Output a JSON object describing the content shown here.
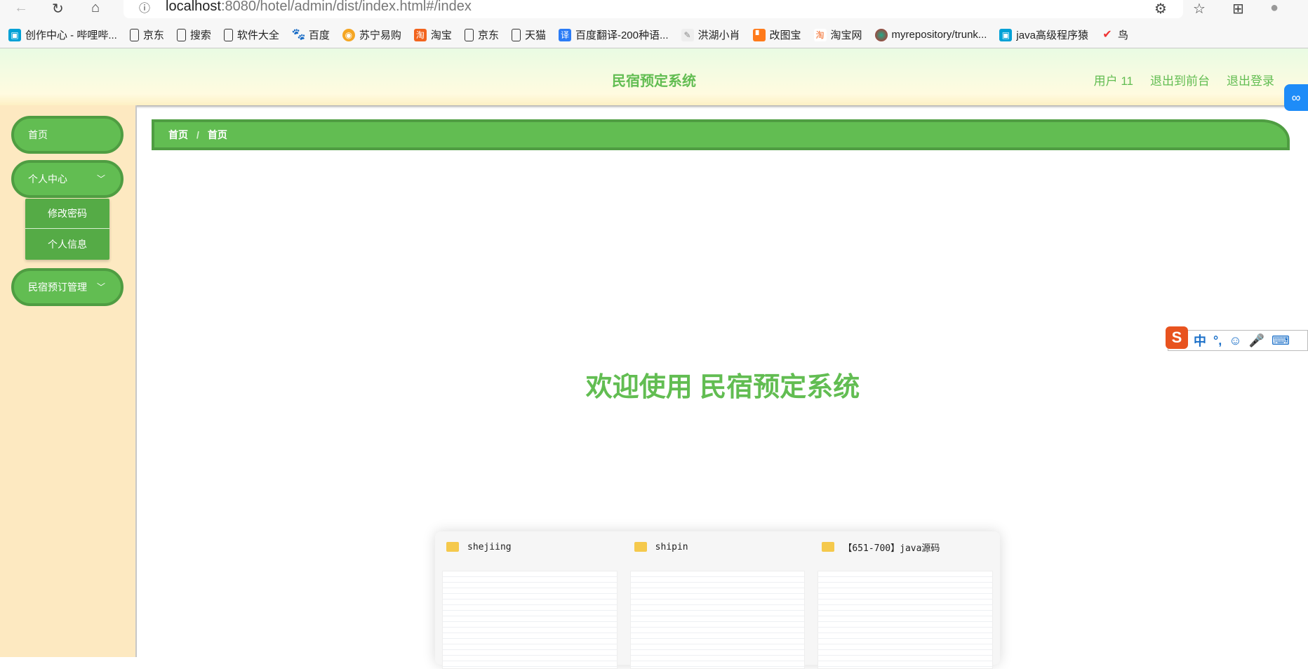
{
  "browser": {
    "url_host": "localhost",
    "url_rest": ":8080/hotel/admin/dist/index.html#/index"
  },
  "bookmarks": [
    "创作中心 - 哔哩哔...",
    "京东",
    "搜索",
    "软件大全",
    "百度",
    "苏宁易购",
    "淘宝",
    "京东",
    "天猫",
    "百度翻译-200种语...",
    "洪湖小肖",
    "改图宝",
    "淘宝网",
    "myrepository/trunk...",
    "java高级程序猿",
    "鸟"
  ],
  "header": {
    "title": "民宿预定系统",
    "user": "用户 11",
    "to_front": "退出到前台",
    "logout": "退出登录"
  },
  "sidebar": {
    "home": "首页",
    "personal": "个人中心",
    "change_password": "修改密码",
    "personal_info": "个人信息",
    "booking": "民宿预订管理"
  },
  "breadcrumb": [
    "首页",
    "首页"
  ],
  "breadcrumb_sep": "/",
  "welcome": "欢迎使用 民宿预定系统",
  "taskbar_preview": [
    "shejiing",
    "shipin",
    "【651-700】java源码"
  ],
  "ime": {
    "logo": "S",
    "items": [
      "中",
      "°,",
      "☺",
      "🎤",
      "⌨"
    ]
  },
  "colors": {
    "accent": "#62bd52",
    "sidebar_bg": "#fde9c1"
  }
}
